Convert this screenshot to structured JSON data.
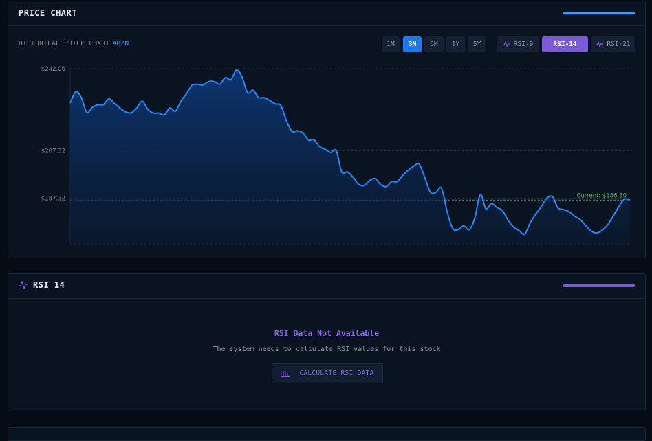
{
  "price_panel": {
    "title": "PRICE CHART",
    "subtitle": "HISTORICAL PRICE CHART",
    "ticker": "AMZN",
    "periods": [
      "1M",
      "3M",
      "6M",
      "1Y",
      "5Y"
    ],
    "active_period": "3M",
    "indicators": [
      "RSI-9",
      "RSI-14",
      "RSI-21"
    ],
    "active_indicator": "RSI-14",
    "accent_color": "#3b9cff"
  },
  "chart_data": {
    "type": "area",
    "y_ticks": [
      "$242.06",
      "$207.32",
      "$187.32"
    ],
    "ylim": [
      168,
      242.06
    ],
    "current_label": "Current: $186.50",
    "current_value": 186.5,
    "grid": true,
    "line_color": "#1f8bff",
    "x": [
      0,
      1,
      2,
      3,
      4,
      5,
      6,
      7,
      8,
      9,
      10,
      11,
      12,
      13,
      14,
      15,
      16,
      17,
      18,
      19,
      20,
      21,
      22,
      23,
      24,
      25,
      26,
      27,
      28,
      29,
      30,
      31,
      32,
      33,
      34,
      35,
      36,
      37,
      38,
      39,
      40,
      41,
      42,
      43,
      44,
      45,
      46,
      47,
      48,
      49,
      50,
      51,
      52,
      53,
      54,
      55,
      56,
      57,
      58,
      59,
      60,
      61,
      62,
      63,
      64,
      65,
      66,
      67,
      68,
      69,
      70,
      71,
      72,
      73,
      74,
      75,
      76,
      77,
      78,
      79,
      80,
      81,
      82,
      83,
      84,
      85,
      86,
      87,
      88,
      89,
      90,
      91,
      92,
      93,
      94,
      95,
      96,
      97,
      98,
      99,
      100,
      101
    ],
    "values": [
      227.5,
      232.3,
      229.9,
      223.6,
      225.7,
      226.8,
      226.9,
      229.3,
      227.3,
      225.4,
      223.8,
      223.4,
      225.4,
      228.3,
      224.9,
      223.3,
      223.3,
      222.6,
      225.5,
      224.1,
      228.4,
      231.6,
      235.1,
      235.4,
      235.2,
      236.6,
      236.6,
      235.5,
      238.3,
      237.4,
      241.5,
      238.6,
      231.9,
      233.0,
      229.8,
      229.8,
      228.6,
      227.2,
      226.5,
      220.2,
      215.6,
      215.8,
      214.9,
      211.9,
      212.0,
      209.1,
      208.0,
      206.6,
      207.4,
      198.4,
      198.4,
      196.3,
      193.3,
      192.7,
      194.7,
      195.6,
      193.2,
      192.2,
      194.3,
      194.3,
      197.0,
      199.1,
      200.9,
      201.6,
      195.9,
      189.8,
      189.8,
      191.5,
      181.7,
      174.6,
      174.0,
      175.6,
      174.0,
      178.9,
      188.8,
      182.8,
      185.0,
      183.4,
      182.0,
      178.0,
      175.1,
      173.6,
      172.1,
      176.9,
      180.6,
      183.8,
      187.3,
      188.0,
      183.2,
      182.5,
      181.6,
      179.7,
      178.3,
      175.7,
      173.4,
      172.6,
      173.8,
      176.1,
      179.9,
      183.8,
      186.9,
      186.5
    ]
  },
  "rsi_panel": {
    "title": "RSI 14",
    "accent_color": "#7b5ad6",
    "empty_title": "RSI Data Not Available",
    "empty_desc": "The system needs to calculate RSI values for this stock",
    "button_label": "CALCULATE RSI DATA"
  }
}
